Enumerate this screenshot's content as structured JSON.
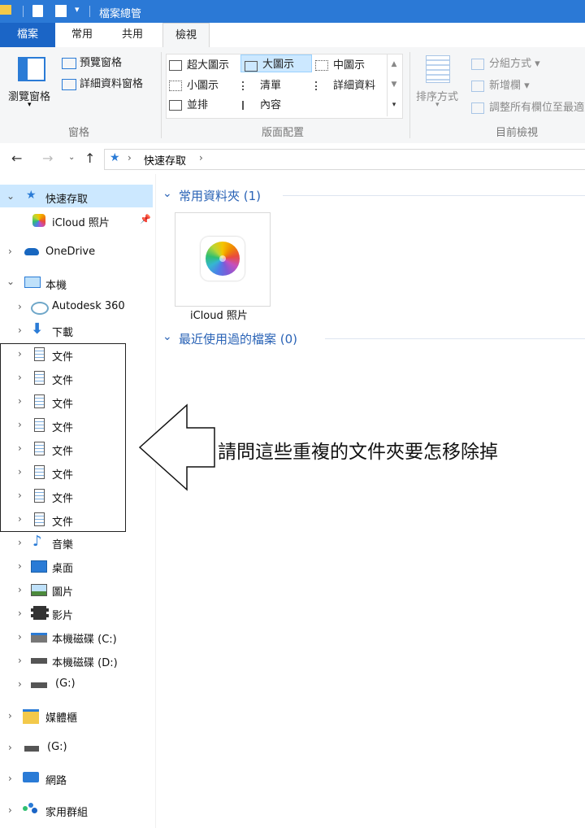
{
  "window": {
    "title": "檔案總管"
  },
  "tabs": [
    "檔案",
    "常用",
    "共用",
    "檢視"
  ],
  "ribbon": {
    "panes_group": {
      "label": "窗格",
      "nav_pane": "瀏覽窗格",
      "preview_pane": "預覽窗格",
      "details_pane": "詳細資料窗格"
    },
    "layout_group": {
      "label": "版面配置",
      "items": [
        "超大圖示",
        "大圖示",
        "中圖示",
        "小圖示",
        "清單",
        "詳細資料",
        "並排",
        "內容"
      ]
    },
    "view_group": {
      "label": "目前檢視",
      "sort_by": "排序方式",
      "group_by": "分組方式",
      "add_columns": "新增欄",
      "size_columns": "調整所有欄位至最適"
    }
  },
  "address": {
    "path": "快速存取"
  },
  "nav": {
    "quick_access": "快速存取",
    "icloud_photos": "iCloud 照片",
    "onedrive": "OneDrive",
    "this_pc": "本機",
    "autodesk": "Autodesk 360",
    "downloads": "下載",
    "documents": [
      "文件",
      "文件",
      "文件",
      "文件",
      "文件",
      "文件",
      "文件",
      "文件"
    ],
    "music": "音樂",
    "desktop": "桌面",
    "pictures": "圖片",
    "videos": "影片",
    "drive_c": "本機磁碟 (C:)",
    "drive_d": "本機磁碟 (D:)",
    "drive_g": "(G:)",
    "media_library": "媒體櫃",
    "drive_g2": "(G:)",
    "network": "網路",
    "homegroup": "家用群組"
  },
  "content": {
    "frequent_folders": "常用資料夾 (1)",
    "icloud_tile": "iCloud 照片",
    "recent_files": "最近使用過的檔案 (0)"
  },
  "annotation": {
    "question": "請問這些重複的文件夾要怎移除掉"
  },
  "colors": {
    "titlebar": "#2b79d6",
    "file_tab": "#1b65c6",
    "link_blue": "#2a63b6",
    "selected_bg": "#cce8ff"
  }
}
